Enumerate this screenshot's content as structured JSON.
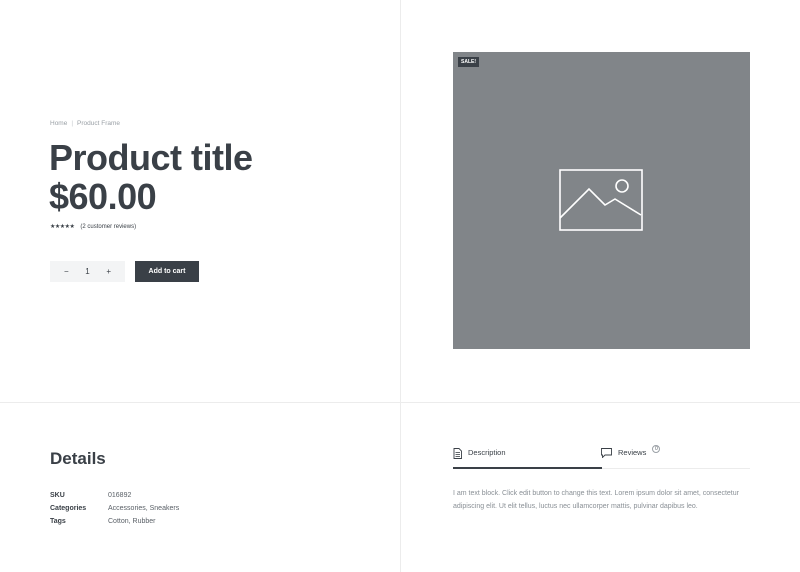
{
  "breadcrumb": {
    "home": "Home",
    "current": "Product Frame"
  },
  "product": {
    "title": "Product title",
    "price": "$60.00",
    "stars": "★★★★★",
    "review_count": "(2 customer reviews)",
    "sale_badge": "SALE!"
  },
  "cart": {
    "minus": "−",
    "quantity": "1",
    "plus": "+",
    "add_label": "Add to cart"
  },
  "details": {
    "title": "Details",
    "rows": [
      {
        "key": "SKU",
        "value": "016892"
      },
      {
        "key": "Categories",
        "value": "Accessories, Sneakers"
      },
      {
        "key": "Tags",
        "value": "Cotton, Rubber"
      }
    ]
  },
  "tabs": {
    "description": "Description",
    "reviews": "Reviews",
    "reviews_count": "0"
  },
  "description_text": "I am text block. Click edit button to change this text. Lorem ipsum dolor sit amet, consectetur adipiscing elit. Ut elit tellus, luctus nec ullamcorper mattis, pulvinar dapibus leo.",
  "colors": {
    "dark": "#3a4047",
    "image_placeholder": "#818589",
    "divider": "#ececec"
  }
}
